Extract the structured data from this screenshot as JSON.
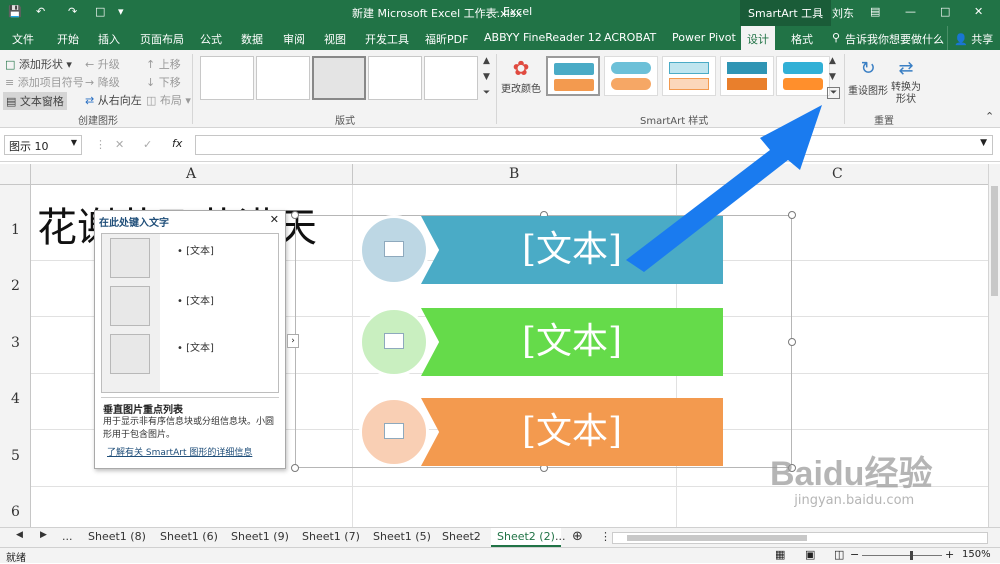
{
  "title_bar": {
    "doc_title": "新建 Microsoft Excel 工作表.xlsx",
    "app_name": "Excel",
    "context_tab": "SmartArt 工具",
    "user": "刘东"
  },
  "ribbon_tabs": [
    "文件",
    "开始",
    "插入",
    "页面布局",
    "公式",
    "数据",
    "审阅",
    "视图",
    "开发工具",
    "福昕PDF",
    "ABBYY FineReader 12",
    "ACROBAT",
    "Power Pivot",
    "设计",
    "格式"
  ],
  "tell_me": "告诉我你想要做什么",
  "share": "共享",
  "create_group": {
    "add_shape": "添加形状",
    "add_bullet": "添加项目符号",
    "text_pane": "文本窗格",
    "promote": "升级",
    "demote": "降级",
    "rtl": "从右向左",
    "move_up": "上移",
    "move_down": "下移",
    "layout": "布局",
    "label": "创建图形"
  },
  "layouts_label": "版式",
  "change_colors": "更改颜色",
  "styles_label": "SmartArt 样式",
  "reset_graphic": "重设图形",
  "convert": "转换为形状",
  "reset_label": "重置",
  "formula_bar": {
    "name_box": "图示 10",
    "fx": "fx"
  },
  "columns": [
    "A",
    "B",
    "C"
  ],
  "rows": [
    "1",
    "2",
    "3",
    "4",
    "5",
    "6"
  ],
  "cell_a1": "花谢花飞花满天",
  "text_pane": {
    "title": "在此处键入文字",
    "bullets": [
      "[文本]",
      "[文本]",
      "[文本]"
    ],
    "layout_name": "垂直图片重点列表",
    "description": "用于显示非有序信息块或分组信息块。小圆形用于包含图片。",
    "link": "了解有关 SmartArt 图形的详细信息"
  },
  "smartart_items": [
    {
      "text": "[文本]",
      "color": "#4aabc6",
      "circle": "#bdd7e4"
    },
    {
      "text": "[文本]",
      "color": "#65db4a",
      "circle": "#c9efc0"
    },
    {
      "text": "[文本]",
      "color": "#f39a4f",
      "circle": "#f9cfb4"
    }
  ],
  "sheet_tabs": [
    "Sheet1 (8)",
    "Sheet1 (6)",
    "Sheet1 (9)",
    "Sheet1 (7)",
    "Sheet1 (5)",
    "Sheet2",
    "Sheet2 (2)"
  ],
  "active_sheet": "Sheet2 (2)",
  "status": {
    "ready": "就绪",
    "zoom": "150%"
  },
  "watermark": {
    "brand": "Baidu经验",
    "url": "jingyan.baidu.com"
  },
  "colors": {
    "excel_green": "#217346",
    "arrow_blue": "#1a7bef"
  }
}
